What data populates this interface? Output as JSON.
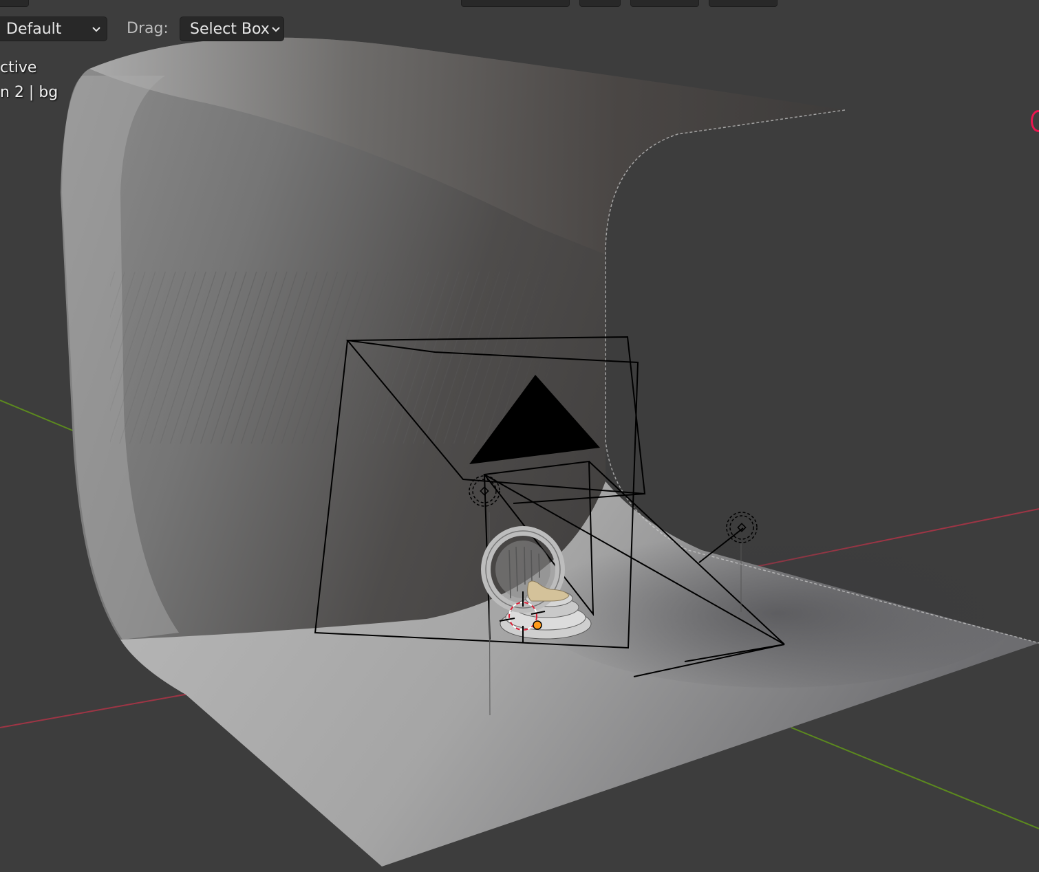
{
  "toolbar": {
    "mode_dropdown": "Default",
    "drag_label": "Drag:",
    "drag_dropdown": "Select Box"
  },
  "viewport_info": {
    "line1": "ctive",
    "line2": "n 2 | bg"
  },
  "icons": {
    "dropdown_chevron": "chevron-down-icon",
    "light_gizmo": "light-icon",
    "camera_gizmo": "camera-icon",
    "cursor_3d": "3d-cursor-icon",
    "object_origin": "origin-dot-icon",
    "nav_axis": "axis-x-icon"
  },
  "colors": {
    "background": "#3d3d3d",
    "x_axis": "#9e3545",
    "y_axis": "#5c8a1e",
    "origin_dot": "#ff9b1a",
    "cursor_red": "#d91e35",
    "nav_axis": "#e8174f"
  }
}
